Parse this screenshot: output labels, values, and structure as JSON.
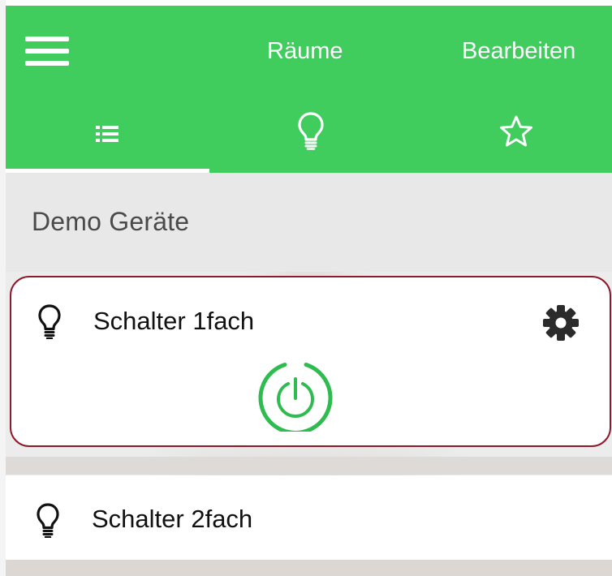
{
  "header": {
    "menu_icon": "hamburger-menu-icon",
    "rooms_label": "Räume",
    "edit_label": "Bearbeiten",
    "background_color": "#40cd5e",
    "tabs": [
      {
        "icon": "list-icon",
        "active": true
      },
      {
        "icon": "lightbulb-icon",
        "active": false
      },
      {
        "icon": "star-icon",
        "active": false
      }
    ]
  },
  "main": {
    "group_title": "Demo Geräte",
    "devices": [
      {
        "name": "Schalter 1fach",
        "icon": "lightbulb-icon",
        "expanded": true,
        "settings_icon": "gear-icon",
        "power_icon": "power-icon",
        "power_color": "#2ebc4f",
        "highlight_color": "#8b1a2c"
      },
      {
        "name": "Schalter 2fach",
        "icon": "lightbulb-icon",
        "expanded": false
      }
    ]
  }
}
